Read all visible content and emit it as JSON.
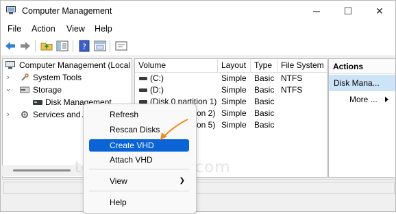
{
  "window": {
    "title": "Computer Management"
  },
  "titlebar_buttons": {
    "minimize": "─",
    "maximize": "☐",
    "close": "✕"
  },
  "menu": [
    "File",
    "Action",
    "View",
    "Help"
  ],
  "tree": {
    "root": "Computer Management (Local",
    "system_tools": "System Tools",
    "storage": "Storage",
    "disk_management": "Disk Management",
    "services": "Services and A"
  },
  "list": {
    "columns": [
      "Volume",
      "Layout",
      "Type",
      "File System"
    ],
    "rows": [
      {
        "volume": "(C:)",
        "layout": "Simple",
        "type": "Basic",
        "fs": "NTFS"
      },
      {
        "volume": "(D:)",
        "layout": "Simple",
        "type": "Basic",
        "fs": "NTFS"
      },
      {
        "volume": "(Disk 0 partition 1)",
        "layout": "Simple",
        "type": "Basic",
        "fs": ""
      },
      {
        "volume": "on 2)",
        "layout": "Simple",
        "type": "Basic",
        "fs": ""
      },
      {
        "volume": "on 5)",
        "layout": "Simple",
        "type": "Basic",
        "fs": ""
      }
    ]
  },
  "actions": {
    "header": "Actions",
    "selected": "Disk Mana...",
    "more": "More ..."
  },
  "context_menu": {
    "refresh": "Refresh",
    "rescan": "Rescan Disks",
    "create_vhd": "Create VHD",
    "attach_vhd": "Attach VHD",
    "view": "View",
    "help": "Help"
  },
  "watermark": "top-password.com",
  "colors": {
    "selection": "#0a64d6",
    "arrow": "#f08a24",
    "action_highlight": "#cde3f7"
  }
}
